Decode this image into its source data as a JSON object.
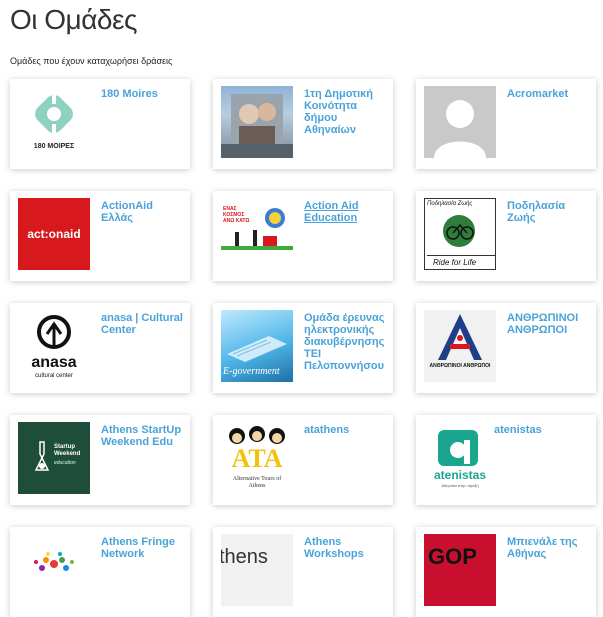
{
  "page": {
    "title": "Οι Ομάδες",
    "subtitle": "Ομάδες που έχουν καταχωρήσει δράσεις"
  },
  "groups": [
    {
      "name": "180 Moires",
      "logo": "180-moires-logo",
      "logo_text": "180 ΜΟΙΡΕΣ"
    },
    {
      "name": "1τη Δημοτική Κοινότητα δήμου Αθηναίων",
      "logo": "mural-photo"
    },
    {
      "name": "Acromarket",
      "logo": "default-avatar-icon"
    },
    {
      "name": "ActionAid Ελλάς",
      "logo": "actionaid-logo",
      "logo_text": "act:onaid"
    },
    {
      "name": "Action Aid Education",
      "logo": "children-drawing-logo",
      "logo_text": "ΕΝΑΣ ΚΟΣΜΟΣ ΑΝΩ ΚΑΤΩ"
    },
    {
      "name": "Ποδηλασία Ζωής",
      "logo": "bicycle-logo",
      "logo_text_top": "Ποδηλασία Ζωής",
      "logo_text_bottom": "Ride for Life"
    },
    {
      "name": "anasa | Cultural Center",
      "logo": "anasa-logo",
      "logo_text": "anasa",
      "logo_subtext": "cultural center"
    },
    {
      "name": "Ομάδα έρευνας ηλεκτρονικής διακυβέρνησης ΤΕΙ Πελοποννήσου",
      "logo": "egovernment-logo",
      "logo_text": "E-government"
    },
    {
      "name": "ΑΝΘΡΩΠΙΝΟΙ ΑΝΘΡΩΠΟΙ",
      "logo": "anthropinoi-logo",
      "logo_text": "ΑΝΘΡΩΠΙΝΟΙ ΑΝΘΡΩΠΟΙ"
    },
    {
      "name": "Athens StartUp Weekend Edu",
      "logo": "startup-weekend-logo",
      "logo_text": "Startup Weekend",
      "logo_subtext": "education"
    },
    {
      "name": "atathens",
      "logo": "ata-logo",
      "logo_text": "ATA",
      "logo_subtext": "Alternative Tours of Athens"
    },
    {
      "name": "atenistas",
      "logo": "atenistas-logo",
      "logo_text": "atenistas",
      "logo_subtext": "Αθηναίοι στην πράξη"
    },
    {
      "name": "Athens Fringe Network",
      "logo": "fringe-logo"
    },
    {
      "name": "Athens Workshops",
      "logo": "workshops-logo",
      "logo_text": "thens"
    },
    {
      "name": "Μπιενάλε της Αθήνας",
      "logo": "biennale-logo",
      "logo_text": "GOP"
    }
  ],
  "colors": {
    "link": "#4aa3d8",
    "actionaid_red": "#d7191e",
    "placeholder_gray": "#c8c8c8",
    "teal": "#1aa68e"
  }
}
